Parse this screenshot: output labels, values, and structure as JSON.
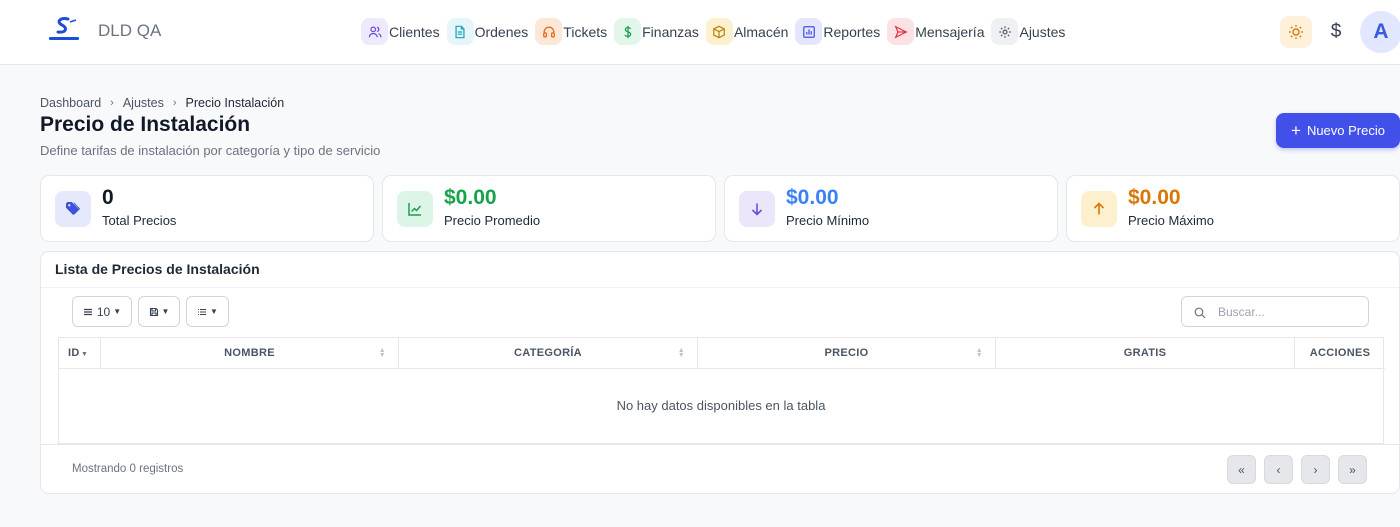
{
  "app": {
    "title": "DLD QA",
    "logo_icon": "skylink-logo-icon"
  },
  "nav": [
    {
      "label": "Clientes",
      "icon": "users-icon",
      "bg": "#ede9fe",
      "fg": "#6d4bd8"
    },
    {
      "label": "Ordenes",
      "icon": "document-icon",
      "bg": "#e6f6f8",
      "fg": "#1aa3b8"
    },
    {
      "label": "Tickets",
      "icon": "headset-icon",
      "bg": "#fde7d6",
      "fg": "#ea6a1a"
    },
    {
      "label": "Finanzas",
      "icon": "dollar-icon",
      "bg": "#e2f7ea",
      "fg": "#1f9d55"
    },
    {
      "label": "Almacén",
      "icon": "box-icon",
      "bg": "#fdf0cf",
      "fg": "#b8860b"
    },
    {
      "label": "Reportes",
      "icon": "bar-chart-icon",
      "bg": "#e4e7fb",
      "fg": "#4050e8"
    },
    {
      "label": "Mensajería",
      "icon": "send-icon",
      "bg": "#fde2e4",
      "fg": "#e0324a"
    },
    {
      "label": "Ajustes",
      "icon": "gear-icon",
      "bg": "#eef0f3",
      "fg": "#4b5563"
    }
  ],
  "topright": {
    "currency_symbol": "$",
    "avatar_initial": "A"
  },
  "breadcrumb": {
    "items": [
      "Dashboard",
      "Ajustes"
    ],
    "current": "Precio Instalación"
  },
  "page": {
    "title": "Precio de Instalación",
    "subtitle": "Define tarifas de instalación por categoría y tipo de servicio",
    "new_button": "Nuevo Precio"
  },
  "stats": [
    {
      "value": "0",
      "label": "Total Precios",
      "icon": "tag-icon",
      "bg": "#e6e9fb",
      "fg": "#3f51d6",
      "value_color": "#111827"
    },
    {
      "value": "$0.00",
      "label": "Precio Promedio",
      "icon": "trend-up-icon",
      "bg": "#dcf5e6",
      "fg": "#1f9d55",
      "value_color": "#16a34a"
    },
    {
      "value": "$0.00",
      "label": "Precio Mínimo",
      "icon": "arrow-down-icon",
      "bg": "#ece6fb",
      "fg": "#6d4bd8",
      "value_color": "#3b82f6"
    },
    {
      "value": "$0.00",
      "label": "Precio Máximo",
      "icon": "arrow-up-icon",
      "bg": "#fdf0cf",
      "fg": "#d97706",
      "value_color": "#d97706"
    }
  ],
  "list": {
    "title": "Lista de Precios de Instalación",
    "page_length": "10",
    "search_placeholder": "Buscar...",
    "columns": [
      "ID",
      "NOMBRE",
      "CATEGORÍA",
      "PRECIO",
      "GRATIS",
      "ACCIONES"
    ],
    "empty_message": "No hay datos disponibles en la tabla",
    "info": "Mostrando 0 registros",
    "pagination": [
      "«",
      "‹",
      "›",
      "»"
    ]
  }
}
